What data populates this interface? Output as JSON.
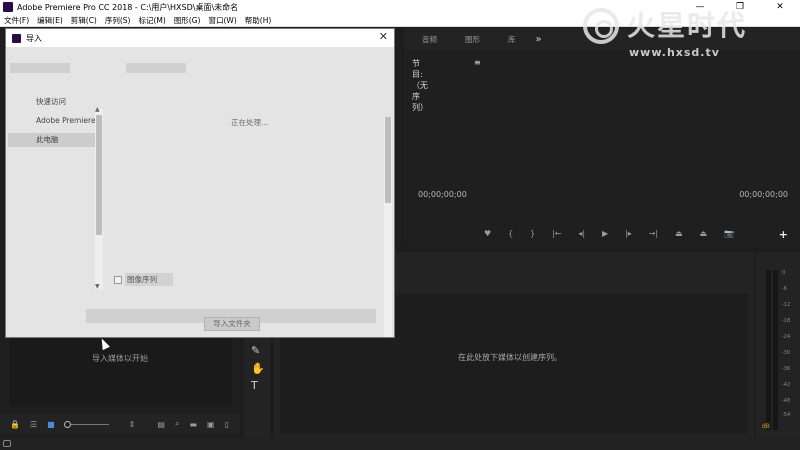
{
  "window": {
    "title": "Adobe Premiere Pro CC 2018 - C:\\用户\\HXSD\\桌面\\未命名",
    "controls": {
      "minimize": "—",
      "maximize": "❐",
      "close": "✕"
    }
  },
  "menu": [
    "文件(F)",
    "编辑(E)",
    "剪辑(C)",
    "序列(S)",
    "标记(M)",
    "图形(G)",
    "窗口(W)",
    "帮助(H)"
  ],
  "program_monitor": {
    "tabs": [
      "音频",
      "图形",
      "库"
    ],
    "more": "»",
    "title": "节目:（无序列）",
    "menu_glyph": "≡",
    "timecode_left": "00;00;00;00",
    "timecode_right": "00;00;00;00",
    "transport": [
      "♥",
      "{",
      "}",
      "|←",
      "◂|",
      "▶",
      "|▸",
      "→|",
      "⏏",
      "⏏",
      "📷"
    ],
    "add_button": "+"
  },
  "logo": {
    "text": "火星时代",
    "url": "www.hxsd.tv"
  },
  "project_panel": {
    "empty_hint": "导入媒体以开始"
  },
  "timeline": {
    "empty_hint": "在此处放下媒体以创建序列。"
  },
  "tools": [
    "✎",
    "✋",
    "T"
  ],
  "audio_meter": {
    "db_labels": [
      "0",
      "-6",
      "-12",
      "-18",
      "-24",
      "-30",
      "-36",
      "-42",
      "-48",
      "-54"
    ],
    "db_bottom": "dB"
  },
  "import_dialog": {
    "title": "导入",
    "close": "✕",
    "nav_items": [
      "快速访问",
      "Adobe Premiere",
      "此电脑"
    ],
    "selected_nav": "此电脑",
    "processing_text": "正在处理...",
    "image_sequence_label": "图像序列",
    "import_folder_button": "导入文件夹"
  }
}
